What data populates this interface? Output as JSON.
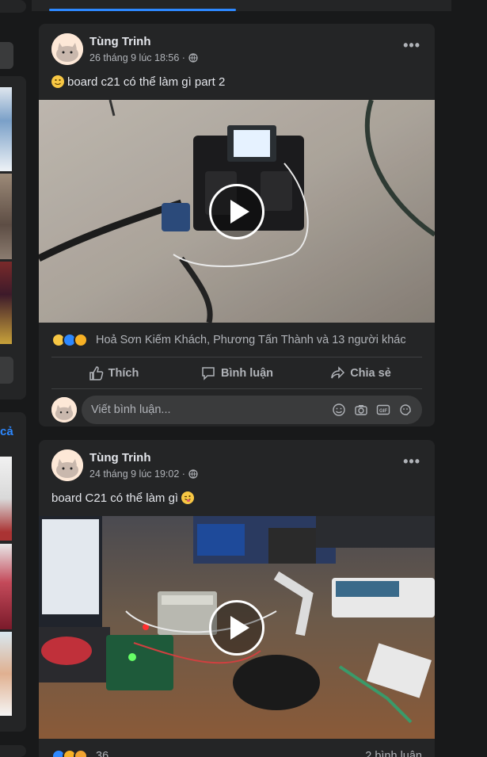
{
  "rail": {
    "see_all_label": "cả"
  },
  "posts": [
    {
      "author": "Tùng Trinh",
      "timestamp": "26 tháng 9 lúc 18:56 ·",
      "text": "board c21 có thể làm gì part 2",
      "leading_emoji": "slightly-smiling-face",
      "reaction_names": "Hoả Sơn Kiếm Khách, Phương Tấn Thành và 13 người khác",
      "reaction_icons": [
        "haha",
        "like",
        "wow"
      ],
      "actions": {
        "like": "Thích",
        "comment": "Bình luận",
        "share": "Chia sẻ"
      },
      "comment_placeholder": "Viết bình luận..."
    },
    {
      "author": "Tùng Trinh",
      "timestamp": "24 tháng 9 lúc 19:02 ·",
      "text": "board C21 có thể làm gì",
      "trailing_emoji": "winking-tongue-face",
      "reaction_count": "36",
      "reaction_icons": [
        "like",
        "wow",
        "care"
      ],
      "comments_count": "2 bình luận"
    }
  ],
  "colors": {
    "background": "#18191a",
    "card": "#242526",
    "accent": "#2d88ff",
    "text_primary": "#e4e6eb",
    "text_secondary": "#b0b3b8"
  }
}
